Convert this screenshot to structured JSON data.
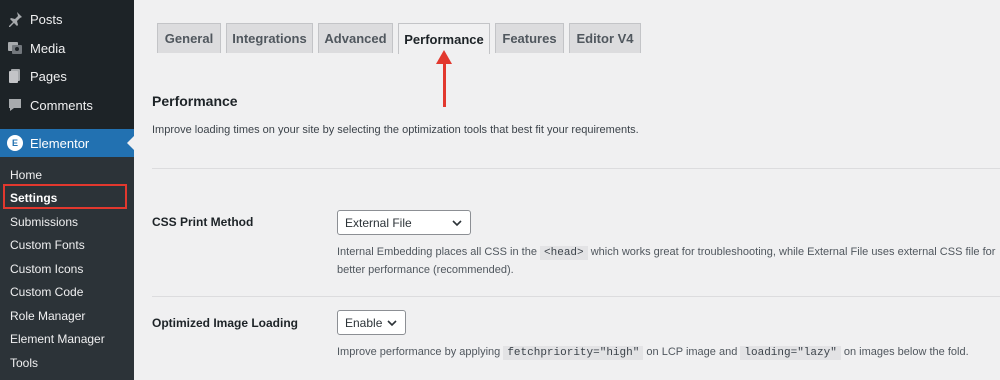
{
  "sidebar": {
    "top_items": [
      {
        "label": "Posts",
        "icon": "pin-icon"
      },
      {
        "label": "Media",
        "icon": "media-icon"
      },
      {
        "label": "Pages",
        "icon": "pages-icon"
      },
      {
        "label": "Comments",
        "icon": "comments-icon"
      }
    ],
    "active_item": {
      "label": "Elementor",
      "icon": "elementor-icon",
      "icon_glyph": "E"
    },
    "submenu": [
      "Home",
      "Settings",
      "Submissions",
      "Custom Fonts",
      "Custom Icons",
      "Custom Code",
      "Role Manager",
      "Element Manager",
      "Tools"
    ]
  },
  "tabs": [
    "General",
    "Integrations",
    "Advanced",
    "Performance",
    "Features",
    "Editor V4"
  ],
  "main": {
    "title": "Performance",
    "description": "Improve loading times on your site by selecting the optimization tools that best fit your requirements.",
    "fields": {
      "css": {
        "label": "CSS Print Method",
        "value": "External File",
        "help_part1": "Internal Embedding places all CSS in the",
        "help_code": "<head>",
        "help_part2": "which works great for troubleshooting, while External File uses external CSS file for",
        "help_part3": "better performance (recommended)."
      },
      "image": {
        "label": "Optimized Image Loading",
        "value": "Enable",
        "help_part1": "Improve performance by applying",
        "help_code1": "fetchpriority=\"high\"",
        "help_part2": "on LCP image and",
        "help_code2": "loading=\"lazy\"",
        "help_part3": "on images below the fold."
      }
    }
  },
  "colors": {
    "sidebar_bg": "#1d2327",
    "submenu_bg": "#2c3338",
    "accent": "#2271b1",
    "annotation": "#e2382e"
  }
}
